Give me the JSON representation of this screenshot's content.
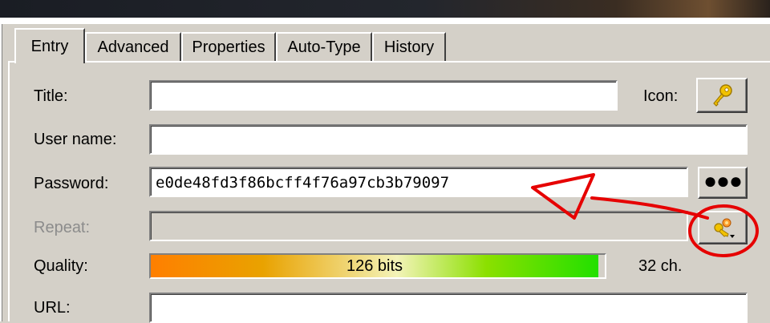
{
  "tabs": [
    {
      "label": "Entry",
      "active": true
    },
    {
      "label": "Advanced",
      "active": false
    },
    {
      "label": "Properties",
      "active": false
    },
    {
      "label": "Auto-Type",
      "active": false
    },
    {
      "label": "History",
      "active": false
    }
  ],
  "form": {
    "title_label": "Title:",
    "title_value": "",
    "icon_label": "Icon:",
    "icon_name": "key-icon",
    "username_label": "User name:",
    "username_value": "",
    "password_label": "Password:",
    "password_value": "e0de48fd3f86bcff4f76a97cb3b79097",
    "show_password_label": "●●●",
    "repeat_label": "Repeat:",
    "repeat_value": "",
    "generator_icon_name": "password-generator-icon",
    "quality_label": "Quality:",
    "quality_text": "126 bits",
    "quality_fraction": 1.0,
    "length_text": "32 ch.",
    "url_label": "URL:",
    "url_value": ""
  },
  "colors": {
    "annotation": "#e60000",
    "window_bg": "#d4d0c8"
  }
}
